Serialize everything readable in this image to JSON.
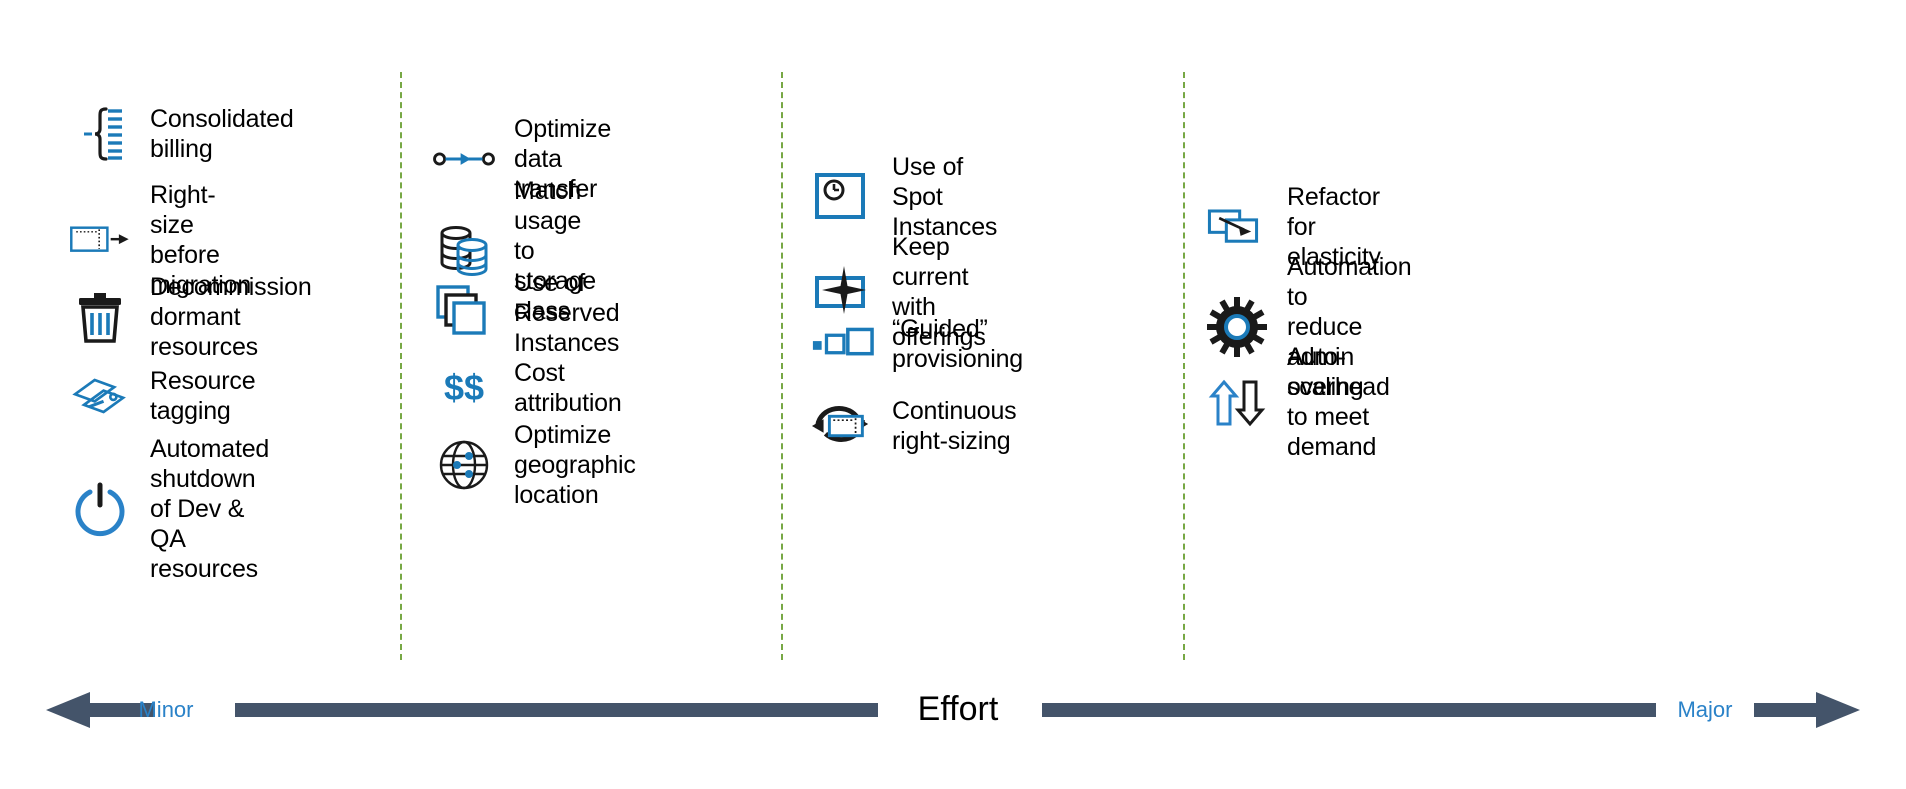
{
  "diagram": {
    "title_axis": "Effort",
    "axis": {
      "left_label": "Minor",
      "right_label": "Major",
      "center_label": "Effort",
      "arrow_color": "#44546a",
      "label_color": "#2a82c8"
    },
    "divider_color": "#77a845",
    "accent_color": "#1b7ab8",
    "dark_color": "#000000"
  },
  "columns": [
    {
      "name": "minor-effort-column",
      "items": [
        {
          "icon": "bracket-list-icon",
          "label": "Consolidated billing"
        },
        {
          "icon": "resize-screen-arrow-icon",
          "label": "Right-size\nbefore migration"
        },
        {
          "icon": "trash-can-icon",
          "label": "Decommission\ndormant resources"
        },
        {
          "icon": "tags-icon",
          "label": "Resource tagging"
        },
        {
          "icon": "power-button-icon",
          "label": "Automated shutdown\nof Dev & QA resources"
        }
      ]
    },
    {
      "name": "low-moderate-effort-column",
      "items": [
        {
          "icon": "node-transfer-arrow-icon",
          "label": "Optimize data transfer"
        },
        {
          "icon": "database-stack-icon",
          "label": "Match usage\nto storage class"
        },
        {
          "icon": "stacked-squares-icon",
          "label": "Use of\nReserved Instances"
        },
        {
          "icon": "double-dollar-icon",
          "label": "Cost attribution"
        },
        {
          "icon": "globe-nodes-icon",
          "label": "Optimize\ngeographic location"
        }
      ]
    },
    {
      "name": "moderate-effort-column",
      "items": [
        {
          "icon": "clock-in-frame-icon",
          "label": "Use of Spot Instances"
        },
        {
          "icon": "sparkle-in-frame-icon",
          "label": "Keep current with offerings"
        },
        {
          "icon": "three-squares-icon",
          "label": "“Guided” provisioning"
        },
        {
          "icon": "refresh-resize-icon",
          "label": "Continuous right-sizing"
        }
      ]
    },
    {
      "name": "major-effort-column",
      "items": [
        {
          "icon": "migrate-window-arrow-icon",
          "label": "Refactor for elasticity"
        },
        {
          "icon": "gear-icon",
          "label": "Automation to\nreduce admin overhead"
        },
        {
          "icon": "up-down-arrows-icon",
          "label": "Auto-scaling\nto meet demand"
        }
      ]
    }
  ]
}
